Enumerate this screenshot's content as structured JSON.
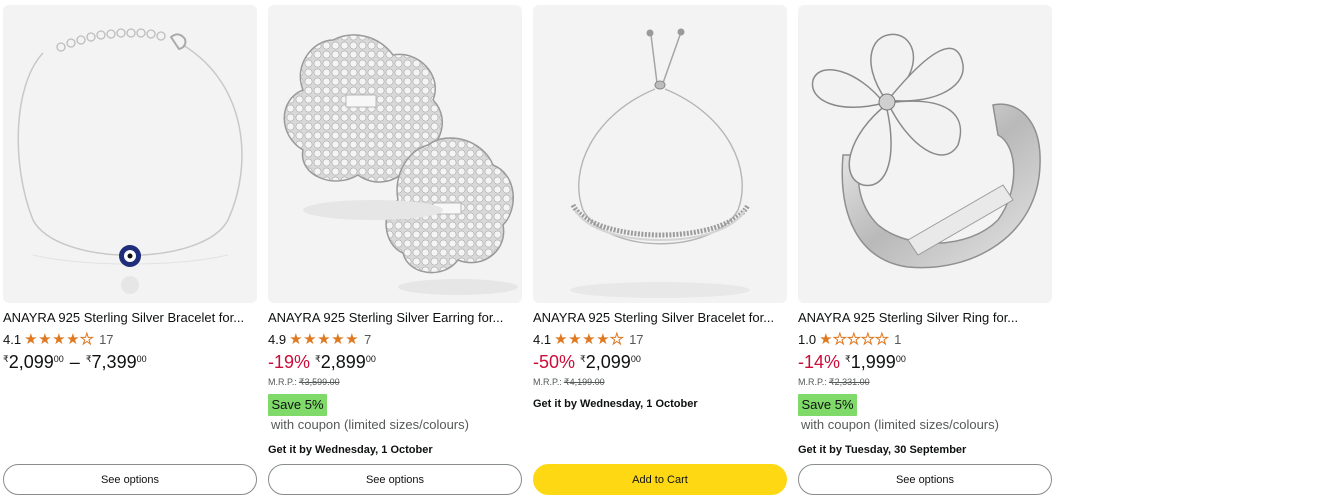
{
  "products": [
    {
      "title": "ANAYRA 925 Sterling Silver Bracelet for...",
      "rating": "4.1",
      "rating_count": "17",
      "price_low": {
        "currency": "₹",
        "whole": "2,099",
        "fraction": "00"
      },
      "price_sep": "–",
      "price_high": {
        "currency": "₹",
        "whole": "7,399",
        "fraction": "00"
      },
      "button": "See options",
      "image_icon": "evil-eye-bracelet-image"
    },
    {
      "title": "ANAYRA 925 Sterling Silver Earring for...",
      "rating": "4.9",
      "rating_count": "7",
      "discount": "-19%",
      "price": {
        "currency": "₹",
        "whole": "2,899",
        "fraction": "00"
      },
      "mrp_label": "M.R.P.:",
      "mrp": "₹3,599.00",
      "coupon_badge": "Save 5%",
      "coupon_text": "with coupon (limited sizes/colours)",
      "delivery": "Get it by Wednesday, 1 October",
      "button": "See options",
      "image_icon": "stud-earrings-image"
    },
    {
      "title": "ANAYRA 925 Sterling Silver Bracelet for...",
      "rating": "4.1",
      "rating_count": "17",
      "discount": "-50%",
      "price": {
        "currency": "₹",
        "whole": "2,099",
        "fraction": "00"
      },
      "mrp_label": "M.R.P.:",
      "mrp": "₹4,199.00",
      "delivery": "Get it by Wednesday, 1 October",
      "button": "Add to Cart",
      "image_icon": "bolo-bracelet-image"
    },
    {
      "title": "ANAYRA 925 Sterling Silver Ring for...",
      "rating": "1.0",
      "rating_count": "1",
      "discount": "-14%",
      "price": {
        "currency": "₹",
        "whole": "1,999",
        "fraction": "00"
      },
      "mrp_label": "M.R.P.:",
      "mrp": "₹2,331.00",
      "coupon_badge": "Save 5%",
      "coupon_text": "with coupon (limited sizes/colours)",
      "delivery": "Get it by Tuesday, 30 September",
      "button": "See options",
      "image_icon": "flower-ring-image"
    }
  ],
  "colors": {
    "star": "#de7921",
    "discount": "#cc0c39",
    "coupon_badge": "#7fda69",
    "add_to_cart": "#ffd814",
    "image_bg": "#f3f3f3"
  }
}
